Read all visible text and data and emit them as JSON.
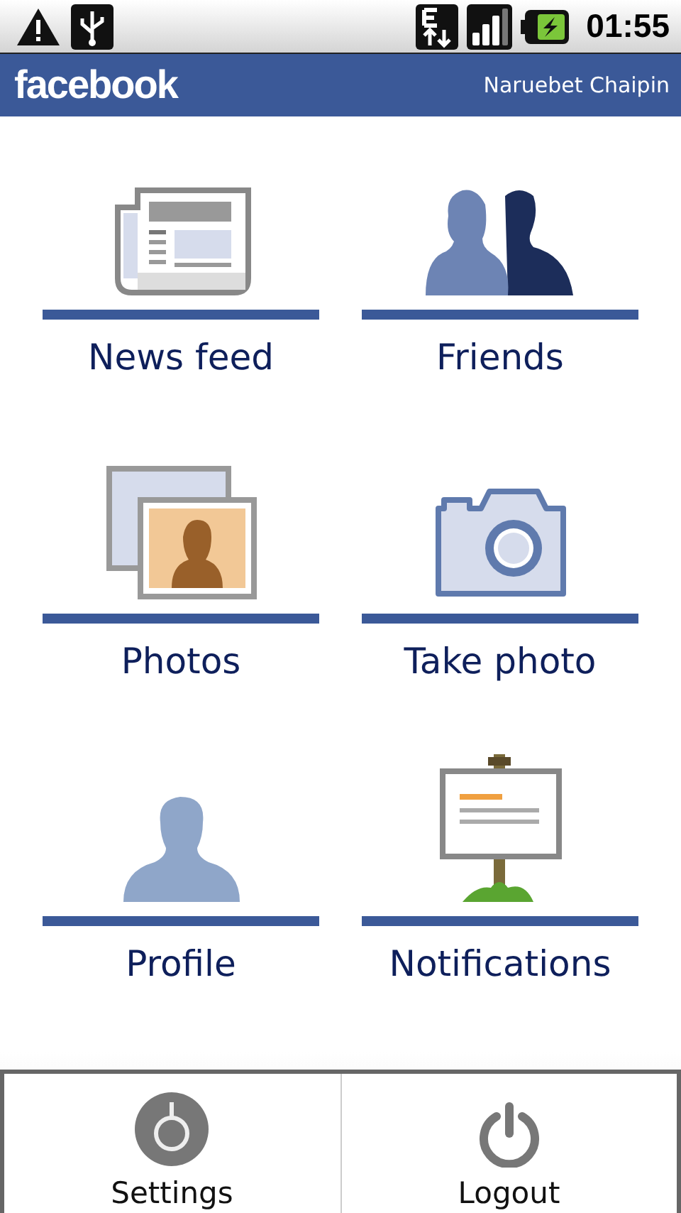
{
  "status_bar": {
    "time": "01:55"
  },
  "header": {
    "logo": "facebook",
    "user_name": "Naruebet Chaipin"
  },
  "tiles": [
    {
      "label": "News feed",
      "kind": "newsfeed"
    },
    {
      "label": "Friends",
      "kind": "friends"
    },
    {
      "label": "Photos",
      "kind": "photos"
    },
    {
      "label": "Take photo",
      "kind": "camera"
    },
    {
      "label": "Profile",
      "kind": "profile"
    },
    {
      "label": "Notifications",
      "kind": "notifications"
    }
  ],
  "bottom_menu": [
    {
      "label": "Settings",
      "kind": "settings"
    },
    {
      "label": "Logout",
      "kind": "logout"
    }
  ]
}
